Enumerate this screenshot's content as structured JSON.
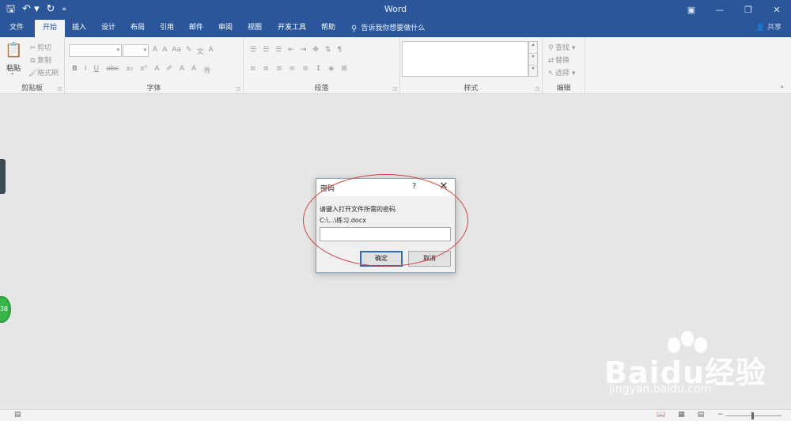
{
  "app": {
    "title": "Word"
  },
  "qat": {
    "save_icon": "save-icon",
    "undo_icon": "undo-icon",
    "redo_icon": "redo-icon",
    "customize_icon": "customize-icon"
  },
  "window_controls": {
    "ribbon_options": "ribbon-display-options-icon",
    "minimize": "minimize-icon",
    "restore": "restore-icon",
    "close": "close-icon"
  },
  "tabs": [
    {
      "label": "文件"
    },
    {
      "label": "开始"
    },
    {
      "label": "插入"
    },
    {
      "label": "设计"
    },
    {
      "label": "布局"
    },
    {
      "label": "引用"
    },
    {
      "label": "邮件"
    },
    {
      "label": "审阅"
    },
    {
      "label": "视图"
    },
    {
      "label": "开发工具"
    },
    {
      "label": "帮助"
    }
  ],
  "tell_me": {
    "placeholder": "告诉我你想要做什么"
  },
  "share": {
    "label": "共享"
  },
  "ribbon": {
    "clipboard": {
      "paste": "粘贴",
      "cut": "剪切",
      "copy": "复制",
      "format_painter": "格式刷",
      "group_label": "剪贴板"
    },
    "font": {
      "group_label": "字体",
      "grow": "A",
      "shrink": "A",
      "case": "Aa",
      "bold": "B",
      "italic": "I",
      "underline": "U",
      "strike": "abc",
      "subscript": "x₂",
      "superscript": "x²"
    },
    "paragraph": {
      "group_label": "段落"
    },
    "styles": {
      "group_label": "样式"
    },
    "editing": {
      "find": "查找",
      "replace": "替换",
      "select": "选择",
      "group_label": "编辑"
    }
  },
  "dialog": {
    "title": "密码",
    "help": "?",
    "prompt": "请键入打开文件所需的密码",
    "path": "C:\\...\\练习.docx",
    "password_value": "",
    "ok_label": "确定",
    "cancel_label": "取消"
  },
  "side_badge": {
    "text": "38"
  },
  "watermark": {
    "brand": "Baidu经验",
    "sub": "jingyan.baidu.com"
  },
  "colors": {
    "accent": "#2b579a",
    "ribbon_bg": "#f3f3f3",
    "doc_bg": "#e6e6e6",
    "annotation": "#d04040",
    "badge": "#38b54a"
  }
}
